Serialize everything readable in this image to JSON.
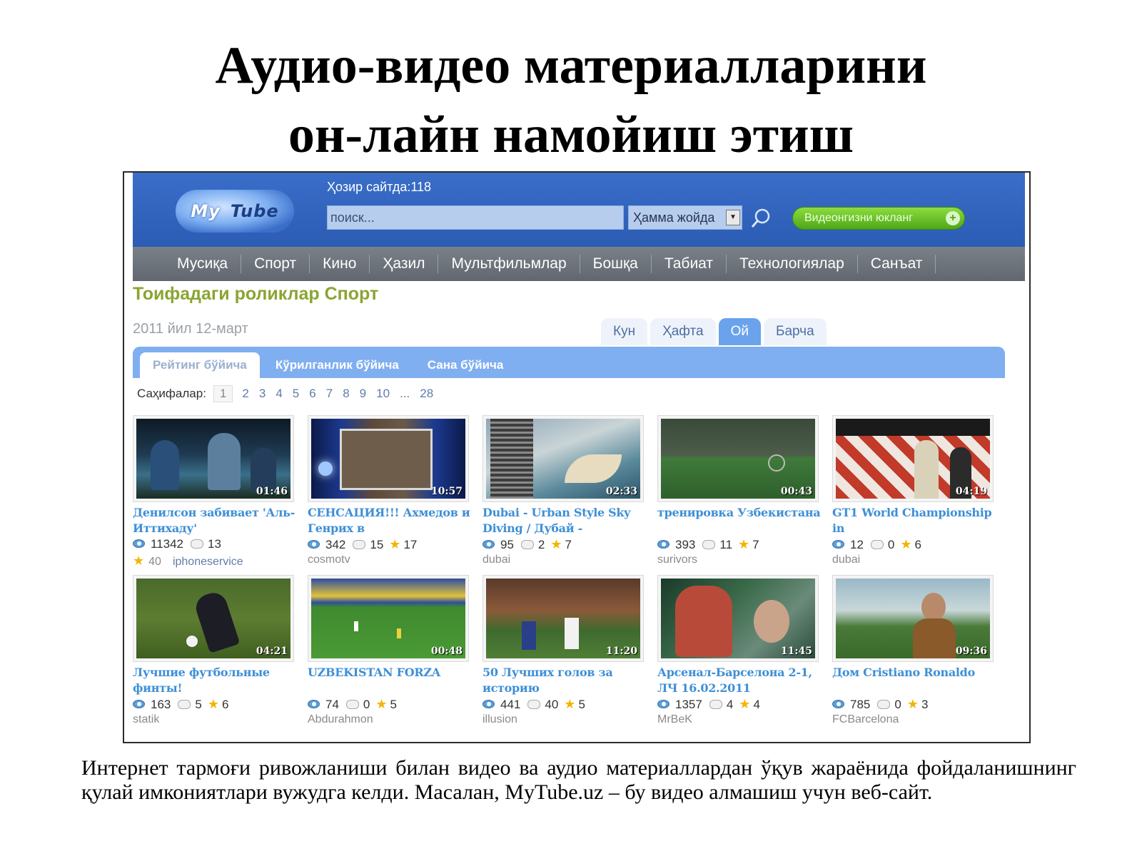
{
  "slide": {
    "title_line1": "Аудио-видео материалларини",
    "title_line2": "он-лайн намойиш этиш",
    "caption": "Интернет тармоғи ривожланиши билан видео ва аудио материаллардан ўқув жараёнида фойдаланишнинг қулай имкониятлари вужудга келди. Масалан, MyTube.uz – бу видео алмашиш учун веб-сайт."
  },
  "header": {
    "logo_my": "My",
    "logo_tube": "Tube",
    "online_now": "Ҳозир сайтда:118",
    "search_placeholder": "поиск...",
    "scope_value": "Ҳамма жойда",
    "upload_label": "Видеонгизни юкланг",
    "upload_plus": "+"
  },
  "nav": {
    "categories": [
      "Мусиқа",
      "Спорт",
      "Кино",
      "Ҳазил",
      "Мультфильмлар",
      "Бошқа",
      "Табиат",
      "Технологиялар",
      "Санъат"
    ]
  },
  "section": {
    "title": "Тоифадаги роликлар Спорт",
    "date": "2011 йил 12-март",
    "period_tabs": [
      "Кун",
      "Ҳафта",
      "Ой",
      "Барча"
    ],
    "active_period": "Ой",
    "sort_tabs": [
      "Рейтинг бўйича",
      "Кўрилганлик бўйича",
      "Сана бўйича"
    ],
    "active_sort": "Рейтинг бўйича"
  },
  "pager": {
    "label": "Саҳифалар:",
    "current": "1",
    "pages": [
      "2",
      "3",
      "4",
      "5",
      "6",
      "7",
      "8",
      "9",
      "10",
      "...",
      "28"
    ]
  },
  "videos": [
    {
      "title": "Денилсон забивает 'Аль-Иттихаду'",
      "duration": "01:46",
      "views": "11342",
      "comments": "13",
      "rating": "40",
      "user": "iphoneservice"
    },
    {
      "title": "СЕНСАЦИЯ!!! Ахмедов и Генрих в",
      "duration": "10:57",
      "views": "342",
      "comments": "15",
      "rating": "17",
      "user": "cosmotv"
    },
    {
      "title": "Dubai - Urban Style Sky Diving / Дубай -",
      "duration": "02:33",
      "views": "95",
      "comments": "2",
      "rating": "7",
      "user": "dubai"
    },
    {
      "title": "тренировка Узбекистана",
      "duration": "00:43",
      "views": "393",
      "comments": "11",
      "rating": "7",
      "user": "surivors"
    },
    {
      "title": "GT1 World Championship in",
      "duration": "04:19",
      "views": "12",
      "comments": "0",
      "rating": "6",
      "user": "dubai"
    },
    {
      "title": "Лучшие футбольные финты!",
      "duration": "04:21",
      "views": "163",
      "comments": "5",
      "rating": "6",
      "user": "statik"
    },
    {
      "title": "UZBEKISTAN FORZA",
      "duration": "00:48",
      "views": "74",
      "comments": "0",
      "rating": "5",
      "user": "Abdurahmon"
    },
    {
      "title": "50 Лучших голов за историю",
      "duration": "11:20",
      "views": "441",
      "comments": "40",
      "rating": "5",
      "user": "illusion"
    },
    {
      "title": "Арсенал-Барселона 2-1, ЛЧ 16.02.2011",
      "duration": "11:45",
      "views": "1357",
      "comments": "4",
      "rating": "4",
      "user": "MrBeK"
    },
    {
      "title": "Дом Cristiano Ronaldo",
      "duration": "09:36",
      "views": "785",
      "comments": "0",
      "rating": "3",
      "user": "FCBarcelona"
    }
  ]
}
